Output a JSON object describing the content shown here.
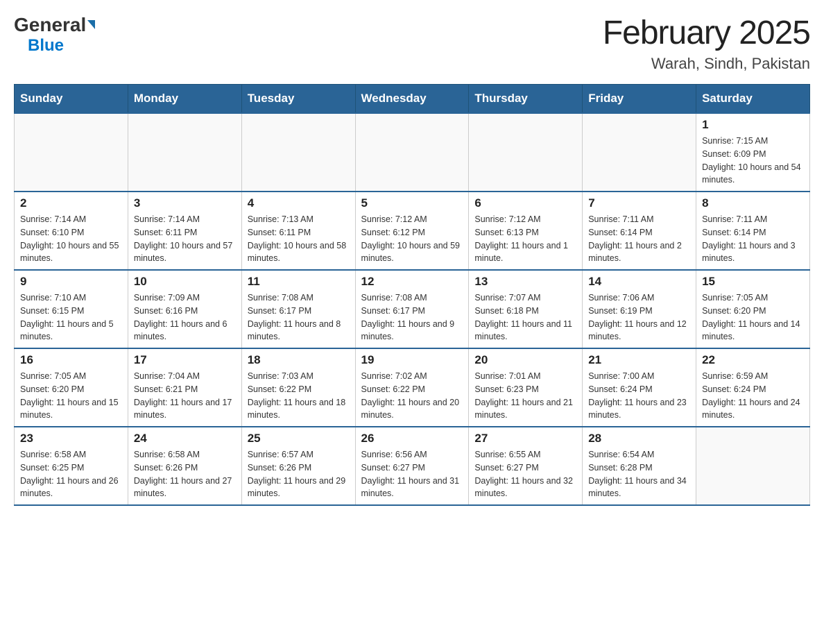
{
  "header": {
    "logo_general": "General",
    "logo_blue": "Blue",
    "month_title": "February 2025",
    "location": "Warah, Sindh, Pakistan"
  },
  "days_of_week": [
    "Sunday",
    "Monday",
    "Tuesday",
    "Wednesday",
    "Thursday",
    "Friday",
    "Saturday"
  ],
  "weeks": [
    {
      "days": [
        {
          "number": "",
          "sunrise": "",
          "sunset": "",
          "daylight": ""
        },
        {
          "number": "",
          "sunrise": "",
          "sunset": "",
          "daylight": ""
        },
        {
          "number": "",
          "sunrise": "",
          "sunset": "",
          "daylight": ""
        },
        {
          "number": "",
          "sunrise": "",
          "sunset": "",
          "daylight": ""
        },
        {
          "number": "",
          "sunrise": "",
          "sunset": "",
          "daylight": ""
        },
        {
          "number": "",
          "sunrise": "",
          "sunset": "",
          "daylight": ""
        },
        {
          "number": "1",
          "sunrise": "Sunrise: 7:15 AM",
          "sunset": "Sunset: 6:09 PM",
          "daylight": "Daylight: 10 hours and 54 minutes."
        }
      ]
    },
    {
      "days": [
        {
          "number": "2",
          "sunrise": "Sunrise: 7:14 AM",
          "sunset": "Sunset: 6:10 PM",
          "daylight": "Daylight: 10 hours and 55 minutes."
        },
        {
          "number": "3",
          "sunrise": "Sunrise: 7:14 AM",
          "sunset": "Sunset: 6:11 PM",
          "daylight": "Daylight: 10 hours and 57 minutes."
        },
        {
          "number": "4",
          "sunrise": "Sunrise: 7:13 AM",
          "sunset": "Sunset: 6:11 PM",
          "daylight": "Daylight: 10 hours and 58 minutes."
        },
        {
          "number": "5",
          "sunrise": "Sunrise: 7:12 AM",
          "sunset": "Sunset: 6:12 PM",
          "daylight": "Daylight: 10 hours and 59 minutes."
        },
        {
          "number": "6",
          "sunrise": "Sunrise: 7:12 AM",
          "sunset": "Sunset: 6:13 PM",
          "daylight": "Daylight: 11 hours and 1 minute."
        },
        {
          "number": "7",
          "sunrise": "Sunrise: 7:11 AM",
          "sunset": "Sunset: 6:14 PM",
          "daylight": "Daylight: 11 hours and 2 minutes."
        },
        {
          "number": "8",
          "sunrise": "Sunrise: 7:11 AM",
          "sunset": "Sunset: 6:14 PM",
          "daylight": "Daylight: 11 hours and 3 minutes."
        }
      ]
    },
    {
      "days": [
        {
          "number": "9",
          "sunrise": "Sunrise: 7:10 AM",
          "sunset": "Sunset: 6:15 PM",
          "daylight": "Daylight: 11 hours and 5 minutes."
        },
        {
          "number": "10",
          "sunrise": "Sunrise: 7:09 AM",
          "sunset": "Sunset: 6:16 PM",
          "daylight": "Daylight: 11 hours and 6 minutes."
        },
        {
          "number": "11",
          "sunrise": "Sunrise: 7:08 AM",
          "sunset": "Sunset: 6:17 PM",
          "daylight": "Daylight: 11 hours and 8 minutes."
        },
        {
          "number": "12",
          "sunrise": "Sunrise: 7:08 AM",
          "sunset": "Sunset: 6:17 PM",
          "daylight": "Daylight: 11 hours and 9 minutes."
        },
        {
          "number": "13",
          "sunrise": "Sunrise: 7:07 AM",
          "sunset": "Sunset: 6:18 PM",
          "daylight": "Daylight: 11 hours and 11 minutes."
        },
        {
          "number": "14",
          "sunrise": "Sunrise: 7:06 AM",
          "sunset": "Sunset: 6:19 PM",
          "daylight": "Daylight: 11 hours and 12 minutes."
        },
        {
          "number": "15",
          "sunrise": "Sunrise: 7:05 AM",
          "sunset": "Sunset: 6:20 PM",
          "daylight": "Daylight: 11 hours and 14 minutes."
        }
      ]
    },
    {
      "days": [
        {
          "number": "16",
          "sunrise": "Sunrise: 7:05 AM",
          "sunset": "Sunset: 6:20 PM",
          "daylight": "Daylight: 11 hours and 15 minutes."
        },
        {
          "number": "17",
          "sunrise": "Sunrise: 7:04 AM",
          "sunset": "Sunset: 6:21 PM",
          "daylight": "Daylight: 11 hours and 17 minutes."
        },
        {
          "number": "18",
          "sunrise": "Sunrise: 7:03 AM",
          "sunset": "Sunset: 6:22 PM",
          "daylight": "Daylight: 11 hours and 18 minutes."
        },
        {
          "number": "19",
          "sunrise": "Sunrise: 7:02 AM",
          "sunset": "Sunset: 6:22 PM",
          "daylight": "Daylight: 11 hours and 20 minutes."
        },
        {
          "number": "20",
          "sunrise": "Sunrise: 7:01 AM",
          "sunset": "Sunset: 6:23 PM",
          "daylight": "Daylight: 11 hours and 21 minutes."
        },
        {
          "number": "21",
          "sunrise": "Sunrise: 7:00 AM",
          "sunset": "Sunset: 6:24 PM",
          "daylight": "Daylight: 11 hours and 23 minutes."
        },
        {
          "number": "22",
          "sunrise": "Sunrise: 6:59 AM",
          "sunset": "Sunset: 6:24 PM",
          "daylight": "Daylight: 11 hours and 24 minutes."
        }
      ]
    },
    {
      "days": [
        {
          "number": "23",
          "sunrise": "Sunrise: 6:58 AM",
          "sunset": "Sunset: 6:25 PM",
          "daylight": "Daylight: 11 hours and 26 minutes."
        },
        {
          "number": "24",
          "sunrise": "Sunrise: 6:58 AM",
          "sunset": "Sunset: 6:26 PM",
          "daylight": "Daylight: 11 hours and 27 minutes."
        },
        {
          "number": "25",
          "sunrise": "Sunrise: 6:57 AM",
          "sunset": "Sunset: 6:26 PM",
          "daylight": "Daylight: 11 hours and 29 minutes."
        },
        {
          "number": "26",
          "sunrise": "Sunrise: 6:56 AM",
          "sunset": "Sunset: 6:27 PM",
          "daylight": "Daylight: 11 hours and 31 minutes."
        },
        {
          "number": "27",
          "sunrise": "Sunrise: 6:55 AM",
          "sunset": "Sunset: 6:27 PM",
          "daylight": "Daylight: 11 hours and 32 minutes."
        },
        {
          "number": "28",
          "sunrise": "Sunrise: 6:54 AM",
          "sunset": "Sunset: 6:28 PM",
          "daylight": "Daylight: 11 hours and 34 minutes."
        },
        {
          "number": "",
          "sunrise": "",
          "sunset": "",
          "daylight": ""
        }
      ]
    }
  ]
}
